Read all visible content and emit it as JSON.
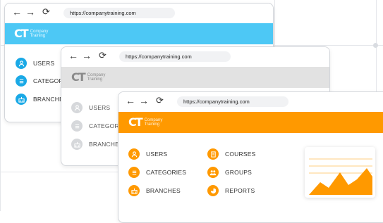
{
  "windows": {
    "back": {
      "url": "https://companytraining.com",
      "logo": {
        "line1": "Company",
        "line2": "Training"
      },
      "menu": [
        {
          "label": "USERS",
          "icon": "user-icon"
        },
        {
          "label": "CATEGORIES",
          "icon": "list-icon"
        },
        {
          "label": "BRANCHES",
          "icon": "branches-icon"
        }
      ],
      "band_color": "#4dc8f5"
    },
    "middle": {
      "url": "https://companytraining.com",
      "logo": {
        "line1": "Company",
        "line2": "Training"
      },
      "menu": [
        {
          "label": "USERS",
          "icon": "user-icon"
        },
        {
          "label": "CATEGORIES",
          "icon": "list-icon"
        },
        {
          "label": "BRANCHES",
          "icon": "branches-icon"
        }
      ],
      "band_color": "#e2e2e2"
    },
    "front": {
      "url": "https://companytraining.com",
      "logo": {
        "line1": "Company",
        "line2": "Training"
      },
      "menu": [
        {
          "label": "USERS",
          "icon": "user-icon"
        },
        {
          "label": "CATEGORIES",
          "icon": "list-icon"
        },
        {
          "label": "BRANCHES",
          "icon": "branches-icon"
        },
        {
          "label": "COURSES",
          "icon": "book-icon"
        },
        {
          "label": "GROUPS",
          "icon": "group-icon"
        },
        {
          "label": "REPORTS",
          "icon": "pie-chart-icon"
        }
      ],
      "band_color": "#ff9900"
    }
  },
  "colors": {
    "accent_blue": "#4dc8f5",
    "accent_orange": "#ff9900",
    "neutral_gray": "#d6d8db"
  }
}
